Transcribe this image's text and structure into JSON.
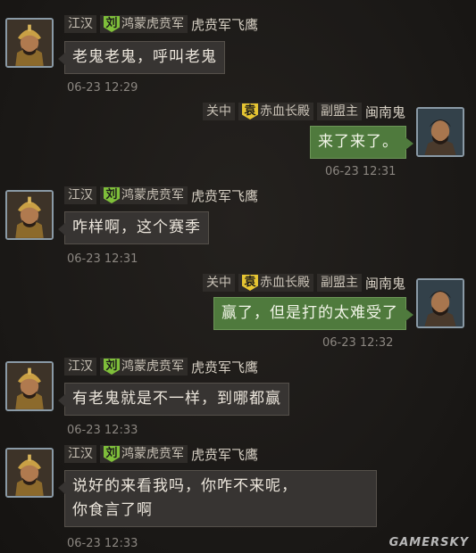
{
  "messages": [
    {
      "side": "left",
      "region": "江汉",
      "badge": "刘",
      "alliance": "鸿蒙虎贲军",
      "sender": "虎贲军飞鹰",
      "lines": [
        "老鬼老鬼，呼叫老鬼"
      ],
      "time": "06-23 12:29"
    },
    {
      "side": "right",
      "region": "关中",
      "badge": "袁",
      "alliance": "赤血长殿",
      "role": "副盟主",
      "sender": "闽南鬼",
      "lines": [
        "来了来了。"
      ],
      "time": "06-23 12:31"
    },
    {
      "side": "left",
      "region": "江汉",
      "badge": "刘",
      "alliance": "鸿蒙虎贲军",
      "sender": "虎贲军飞鹰",
      "lines": [
        "咋样啊，这个赛季"
      ],
      "time": "06-23 12:31"
    },
    {
      "side": "right",
      "region": "关中",
      "badge": "袁",
      "alliance": "赤血长殿",
      "role": "副盟主",
      "sender": "闽南鬼",
      "lines": [
        "赢了，但是打的太难受了"
      ],
      "time": "06-23 12:32"
    },
    {
      "side": "left",
      "region": "江汉",
      "badge": "刘",
      "alliance": "鸿蒙虎贲军",
      "sender": "虎贲军飞鹰",
      "lines": [
        "有老鬼就是不一样，到哪都赢"
      ],
      "time": "06-23 12:33"
    },
    {
      "side": "left",
      "region": "江汉",
      "badge": "刘",
      "alliance": "鸿蒙虎贲军",
      "sender": "虎贲军飞鹰",
      "lines": [
        "说好的来看我吗，你咋不来呢，",
        "你食言了啊"
      ],
      "time": "06-23 12:33"
    }
  ],
  "watermark": "GAMERSKY",
  "colors": {
    "left_bubble": "#373432",
    "right_bubble": "#4f7a3d",
    "badge_left": "#7fbf3a",
    "badge_right": "#e6c533"
  }
}
